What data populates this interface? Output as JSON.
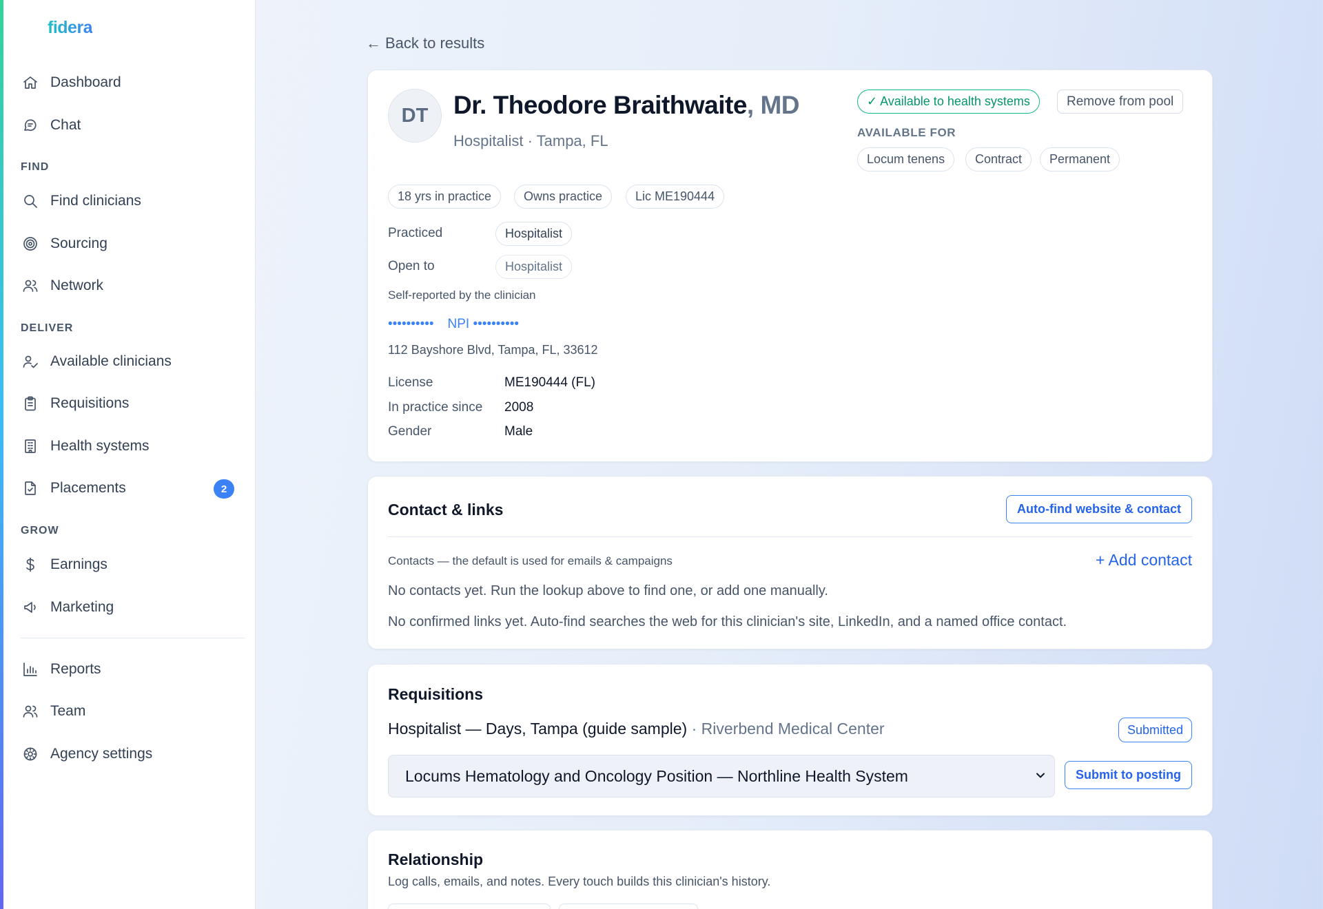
{
  "brand": "fidera",
  "sidebar": {
    "top_items": [
      {
        "label": "Dashboard",
        "icon": "home-icon"
      },
      {
        "label": "Chat",
        "icon": "chat-icon"
      }
    ],
    "sections": {
      "find": "FIND",
      "deliver": "DELIVER",
      "grow": "GROW"
    },
    "find_items": [
      {
        "label": "Find clinicians",
        "icon": "search-icon"
      },
      {
        "label": "Sourcing",
        "icon": "target-icon"
      },
      {
        "label": "Network",
        "icon": "users-icon"
      }
    ],
    "deliver_items": [
      {
        "label": "Available clinicians",
        "icon": "user-check-icon"
      },
      {
        "label": "Requisitions",
        "icon": "clipboard-icon"
      },
      {
        "label": "Health systems",
        "icon": "building-icon"
      },
      {
        "label": "Placements",
        "icon": "file-check-icon",
        "badge": "2"
      }
    ],
    "grow_items": [
      {
        "label": "Earnings",
        "icon": "dollar-icon"
      },
      {
        "label": "Marketing",
        "icon": "megaphone-icon"
      }
    ],
    "bottom_items": [
      {
        "label": "Reports",
        "icon": "bar-chart-icon"
      },
      {
        "label": "Team",
        "icon": "users-icon"
      },
      {
        "label": "Agency settings",
        "icon": "gear-icon"
      }
    ]
  },
  "back_link": "Back to results",
  "profile": {
    "initials": "DT",
    "name": "Dr. Theodore Braithwaite",
    "credential": ", MD",
    "subtitle": "Hospitalist · Tampa, FL",
    "availability": "✓ Available to health systems",
    "remove_button": "Remove from pool",
    "available_for_label": "AVAILABLE FOR",
    "available_for": [
      "Locum tenens",
      "Contract",
      "Permanent"
    ],
    "tags": [
      "18 yrs in practice",
      "Owns practice",
      "Lic ME190444"
    ],
    "practiced_label": "Practiced",
    "practiced": "Hospitalist",
    "open_to_label": "Open to",
    "open_to": "Hospitalist",
    "self_reported": "Self-reported by the clinician",
    "masked_phone": "••••••••••",
    "npi_label": "NPI",
    "masked_npi": "••••••••••",
    "address": "112 Bayshore Blvd, Tampa, FL, 33612",
    "details": [
      {
        "label": "License",
        "value": "ME190444 (FL)"
      },
      {
        "label": "In practice since",
        "value": "2008"
      },
      {
        "label": "Gender",
        "value": "Male"
      }
    ]
  },
  "contact": {
    "title": "Contact & links",
    "autofind_button": "Auto-find website & contact",
    "contacts_note": "Contacts — the default is used for emails & campaigns",
    "add_contact": "+ Add contact",
    "no_contacts": "No contacts yet. Run the lookup above to find one, or add one manually.",
    "no_links": "No confirmed links yet. Auto-find searches the web for this clinician's site, LinkedIn, and a named office contact."
  },
  "requisitions": {
    "title": "Requisitions",
    "item_title": "Hospitalist — Days, Tampa (guide sample)",
    "item_org": " · Riverbend Medical Center",
    "item_status": "Submitted",
    "select_value": "Locums Hematology and Oncology Position — Northline Health System",
    "submit_button": "Submit to posting"
  },
  "relationship": {
    "title": "Relationship",
    "description": "Log calls, emails, and notes. Every touch builds this clinician's history."
  }
}
